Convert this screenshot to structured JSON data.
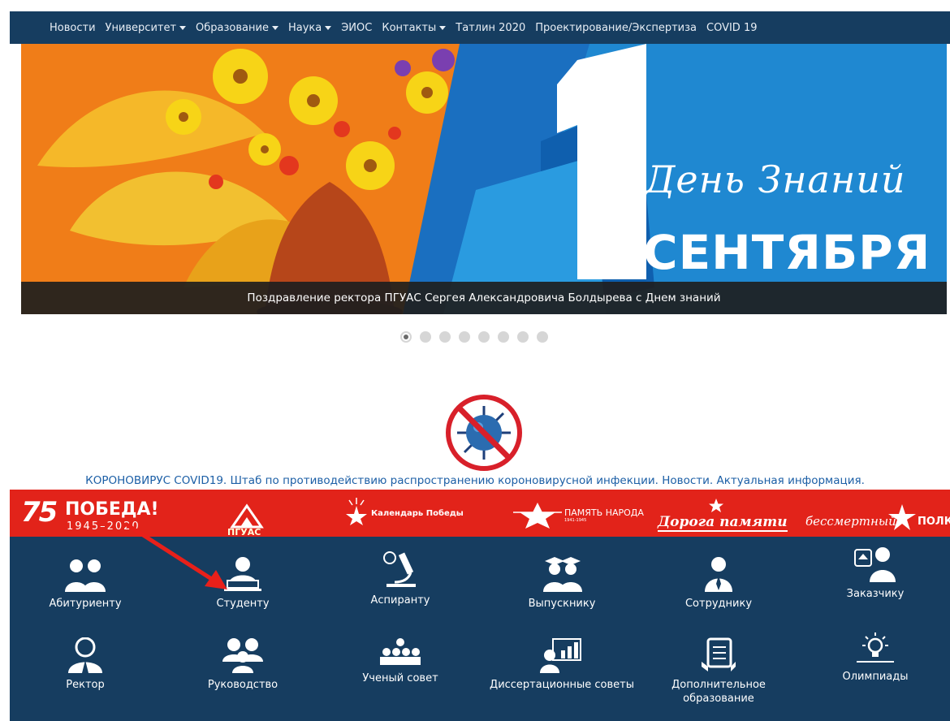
{
  "nav": {
    "items": [
      {
        "label": "Новости",
        "dropdown": false
      },
      {
        "label": "Университет",
        "dropdown": true
      },
      {
        "label": "Образование",
        "dropdown": true
      },
      {
        "label": "Наука",
        "dropdown": true
      },
      {
        "label": "ЭИОС",
        "dropdown": false
      },
      {
        "label": "Контакты",
        "dropdown": true
      },
      {
        "label": "Татлин 2020",
        "dropdown": false
      },
      {
        "label": "Проектирование/Экспертиза",
        "dropdown": false
      },
      {
        "label": "COVID 19",
        "dropdown": false
      }
    ]
  },
  "slider": {
    "slide_day": "День Знаний",
    "slide_number": "1",
    "slide_month": "СЕНТЯБРЯ",
    "caption": "Поздравление ректора ПГУАС Сергея Александровича Болдырева с Днем знаний",
    "dot_count": 8,
    "active_dot": 1
  },
  "covid": {
    "link_text": "КОРОНОВИРУС COVID19. Штаб по противодействию распространению короновирусной инфекции. Новости. Актуальная информация."
  },
  "pobeda": {
    "num": "75",
    "title": "ПОБЕДА!",
    "years": "1945–2020",
    "pguas": "ПГУАС",
    "calendar": "Календарь Победы",
    "pamyat": "ПАМЯТЬ НАРОДА",
    "pamyat_years": "1941-1945",
    "doroga": "Дорога памяти",
    "bessmertny": "бессмертный",
    "polk": "ПОЛК"
  },
  "audience": {
    "row1": [
      {
        "label": "Абитуриенту",
        "icon": "applicants-icon"
      },
      {
        "label": "Студенту",
        "icon": "student-icon"
      },
      {
        "label": "Аспиранту",
        "icon": "microscope-icon"
      },
      {
        "label": "Выпускнику",
        "icon": "graduates-icon"
      },
      {
        "label": "Сотруднику",
        "icon": "employee-icon"
      },
      {
        "label": "Заказчику",
        "icon": "customer-icon"
      }
    ],
    "row2": [
      {
        "label": "Ректор",
        "icon": "rector-icon"
      },
      {
        "label": "Руководство",
        "icon": "management-icon"
      },
      {
        "label": "Ученый совет",
        "icon": "academic-council-icon"
      },
      {
        "label": "Диссертационные советы",
        "icon": "presentation-icon"
      },
      {
        "label": "Дополнительное образование",
        "icon": "book-icon"
      },
      {
        "label": "Олимпиады",
        "icon": "lightbulb-icon"
      }
    ]
  },
  "colors": {
    "nav_bg": "#163d60",
    "accent_red": "#e2231a",
    "link_blue": "#1c5fa6"
  }
}
